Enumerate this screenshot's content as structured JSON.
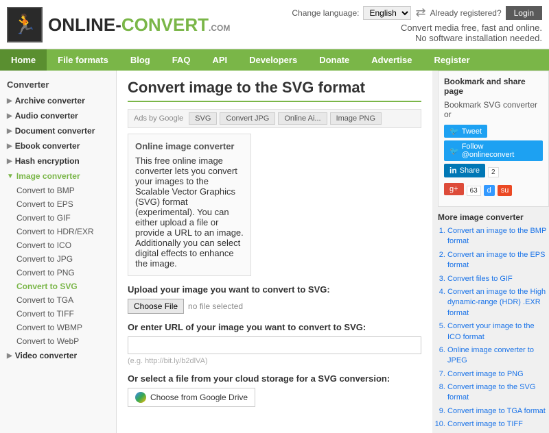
{
  "header": {
    "logo_online": "ONLINE-",
    "logo_convert": "CONVERT",
    "logo_com": ".COM",
    "tagline_line1": "Convert media free, fast and online.",
    "tagline_line2": "No software installation needed.",
    "lang_label": "Change language:",
    "lang_value": "English",
    "already_registered": "Already registered?",
    "login_label": "Login"
  },
  "nav": {
    "items": [
      {
        "label": "Home",
        "active": true
      },
      {
        "label": "File formats",
        "active": false
      },
      {
        "label": "Blog",
        "active": false
      },
      {
        "label": "FAQ",
        "active": false
      },
      {
        "label": "API",
        "active": false
      },
      {
        "label": "Developers",
        "active": false
      },
      {
        "label": "Donate",
        "active": false
      },
      {
        "label": "Advertise",
        "active": false
      },
      {
        "label": "Register",
        "active": false
      }
    ]
  },
  "sidebar": {
    "title": "Converter",
    "categories": [
      {
        "label": "Archive converter",
        "expanded": false,
        "arrow": "▶"
      },
      {
        "label": "Audio converter",
        "expanded": false,
        "arrow": "▶"
      },
      {
        "label": "Document converter",
        "expanded": false,
        "arrow": "▶"
      },
      {
        "label": "Ebook converter",
        "expanded": false,
        "arrow": "▶"
      },
      {
        "label": "Hash encryption",
        "expanded": false,
        "arrow": "▶"
      },
      {
        "label": "Image converter",
        "expanded": true,
        "arrow": "▼"
      }
    ],
    "image_items": [
      "Convert to BMP",
      "Convert to EPS",
      "Convert to GIF",
      "Convert to HDR/EXR",
      "Convert to ICO",
      "Convert to JPG",
      "Convert to PNG",
      "Convert to SVG",
      "Convert to TGA",
      "Convert to TIFF",
      "Convert to WBMP",
      "Convert to WebP"
    ],
    "video_label": "Video converter",
    "video_arrow": "▶"
  },
  "main": {
    "page_title": "Convert image to the SVG format",
    "ads_label": "Ads by Google",
    "ad_tabs": [
      "SVG",
      "Convert JPG",
      "Online Ai...",
      "Image PNG"
    ],
    "converter_box_title": "Online image converter",
    "converter_desc": "This free online image converter lets you convert your images to the Scalable Vector Graphics (SVG) format (experimental). You can either upload a file or provide a URL to an image. Additionally you can select digital effects to enhance the image.",
    "upload_label": "Upload your image you want to convert to SVG:",
    "choose_file": "Choose File",
    "no_file": "no file selected",
    "url_label": "Or enter URL of your image you want to convert to SVG:",
    "url_placeholder": "",
    "url_hint": "(e.g. http://bit.ly/b2dlVA)",
    "cloud_label": "Or select a file from your cloud storage for a SVG conversion:",
    "google_drive": "Choose from Google Drive"
  },
  "right_panel": {
    "bookmark_title": "Bookmark and share page",
    "bookmark_text": "Bookmark SVG converter or",
    "tweet": "Tweet",
    "follow": "Follow @onlineconvert",
    "share": "Share",
    "share_count": "2",
    "gplus_count": "63",
    "more_title": "More image converter",
    "converters": [
      "Convert an image to the BMP format",
      "Convert an image to the EPS format",
      "Convert files to GIF",
      "Convert an image to the High dynamic-range (HDR) .EXR format",
      "Convert your image to the ICO format",
      "Online image converter to JPEG",
      "Convert image to PNG",
      "Convert image to the SVG format",
      "Convert image to TGA format",
      "Convert image to TIFF"
    ]
  }
}
